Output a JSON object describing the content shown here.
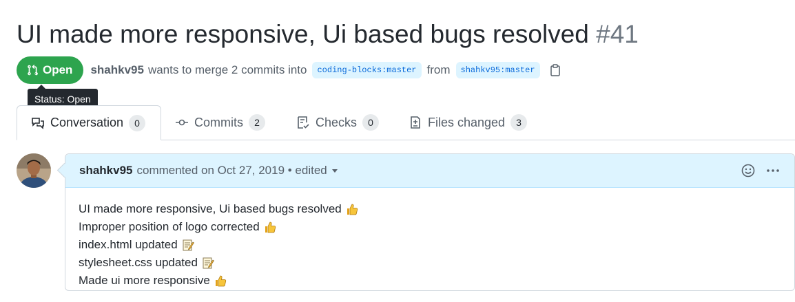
{
  "pr": {
    "title": "UI made more responsive, Ui based bugs resolved",
    "number": "#41",
    "state": "Open",
    "author": "shahkv95",
    "merge_text": "wants to merge 2 commits into",
    "base_branch": "coding-blocks:master",
    "from_text": "from",
    "head_branch": "shahkv95:master"
  },
  "tooltip": "Status: Open",
  "tabs": [
    {
      "label": "Conversation",
      "count": "0",
      "icon": "comment-discussion-icon"
    },
    {
      "label": "Commits",
      "count": "2",
      "icon": "git-commit-icon"
    },
    {
      "label": "Checks",
      "count": "0",
      "icon": "checklist-icon"
    },
    {
      "label": "Files changed",
      "count": "3",
      "icon": "file-diff-icon"
    }
  ],
  "comment": {
    "author": "shahkv95",
    "meta": "commented on Oct 27, 2019 • edited",
    "lines": [
      {
        "text": "UI made more responsive, Ui based bugs resolved",
        "emoji": "thumbs-up-icon"
      },
      {
        "text": "Improper position of logo corrected",
        "emoji": "thumbs-up-icon"
      },
      {
        "text": "index.html updated",
        "emoji": "memo-icon"
      },
      {
        "text": "stylesheet.css updated",
        "emoji": "memo-icon"
      },
      {
        "text": "Made ui more responsive",
        "emoji": "thumbs-up-icon"
      }
    ]
  },
  "colors": {
    "open_green": "#2da44e",
    "link_blue": "#0969da",
    "header_bg": "#ddf4ff"
  }
}
